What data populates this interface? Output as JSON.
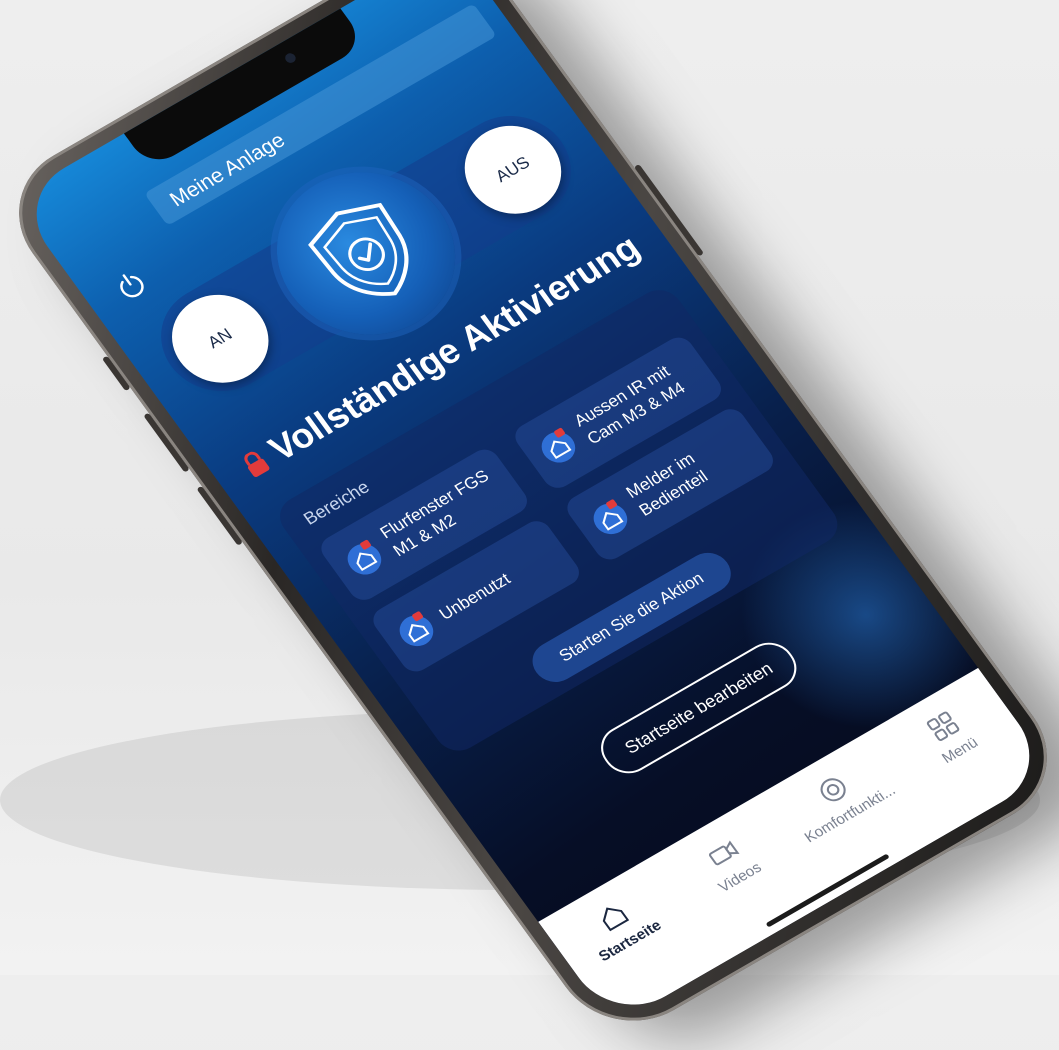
{
  "header": {
    "title": "Meine Anlage"
  },
  "modes": {
    "on_label": "AN",
    "off_label": "AUS"
  },
  "status": {
    "label": "Vollständige Aktivierung"
  },
  "areas": {
    "label": "Bereiche",
    "items": [
      {
        "label": "Flurfenster FGS M1 & M2"
      },
      {
        "label": "Aussen IR mit Cam M3 & M4"
      },
      {
        "label": "Unbenutzt"
      },
      {
        "label": "Melder im Bedienteil"
      }
    ],
    "action_label": "Starten Sie die Aktion"
  },
  "edit_home_label": "Startseite bearbeiten",
  "nav": {
    "items": [
      {
        "label": "Startseite",
        "icon": "home-icon",
        "active": true
      },
      {
        "label": "Videos",
        "icon": "video-camera-icon",
        "active": false
      },
      {
        "label": "Komfortfunkti...",
        "icon": "comfort-functions-icon",
        "active": false
      },
      {
        "label": "Menü",
        "icon": "grid-menu-icon",
        "active": false
      }
    ]
  },
  "colors": {
    "screen_top": "#1688d8",
    "screen_bottom": "#050a1c",
    "lock_red": "#e23b3b",
    "nav_active": "#1b2740"
  }
}
